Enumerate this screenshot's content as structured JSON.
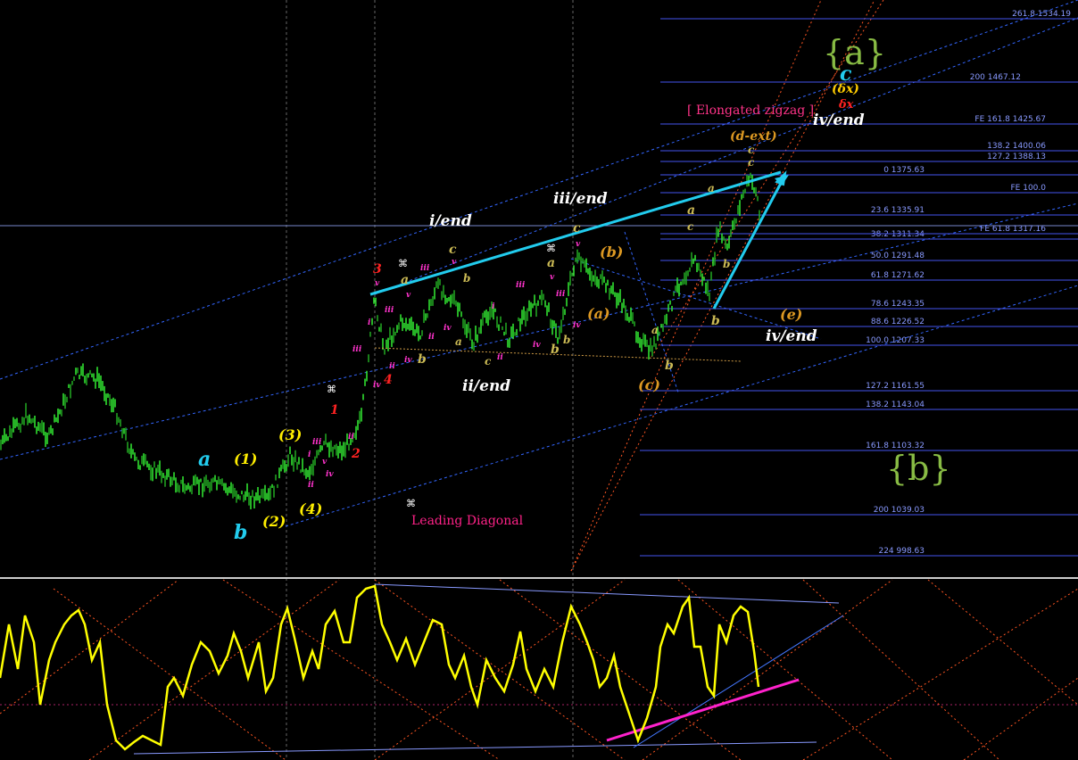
{
  "chart_data": {
    "type": "line",
    "title": "",
    "colors": {
      "background": "#000000",
      "price_candles": "#33ee33",
      "oscillator": "#ffff00",
      "fib_levels": "#5566ff",
      "channel_lines": "#3366ff",
      "cyan_trendline": "#22ccee",
      "magenta_trendline": "#ff22cc",
      "orange_fan": "#ff5522"
    },
    "fib_levels": [
      {
        "label": "261.8 1534.19"
      },
      {
        "label": "200 1467.12"
      },
      {
        "label": "FE 161.8 1425.67"
      },
      {
        "label": "138.2 1400.06"
      },
      {
        "label": "127.2 1388.13"
      },
      {
        "label": "0 1375.63"
      },
      {
        "label": "FE 100.0"
      },
      {
        "label": "23.6 1335.91"
      },
      {
        "label": "38.2 1311.34"
      },
      {
        "label": "FE 61.8 1317.16"
      },
      {
        "label": "50.0 1291.48"
      },
      {
        "label": "61.8 1271.62"
      },
      {
        "label": "78.6 1243.35"
      },
      {
        "label": "88.6 1226.52"
      },
      {
        "label": "100.0 1207.33"
      },
      {
        "label": "127.2 1161.55"
      },
      {
        "label": "138.2 1143.04"
      },
      {
        "label": "161.8 1103.32"
      },
      {
        "label": "200 1039.03"
      },
      {
        "label": "224 998.63"
      }
    ],
    "annotations": {
      "a_big": "{a}",
      "b_big": "{b}",
      "elongated": "[ Elongated zigzag ]",
      "leading_diagonal": "Leading Diagonal",
      "i_end": "i/end",
      "ii_end": "ii/end",
      "iii_end": "iii/end",
      "iv_end_top": "iv/end",
      "iv_end_mid": "iv/end",
      "d_ext": "(d-ext)",
      "c_cyan": "c",
      "delta_x_yellow": "(δx)",
      "delta_x_red": "δx",
      "a_cyan": "a",
      "b_cyan": "b",
      "w1": "(1)",
      "w2": "(2)",
      "w3": "(3)",
      "w4": "(4)",
      "pa": "(a)",
      "pb": "(b)",
      "pc": "(c)",
      "pe": "(e)",
      "r1": "1",
      "r2": "2",
      "r3": "3",
      "r4": "4",
      "sym": "⌘"
    }
  }
}
